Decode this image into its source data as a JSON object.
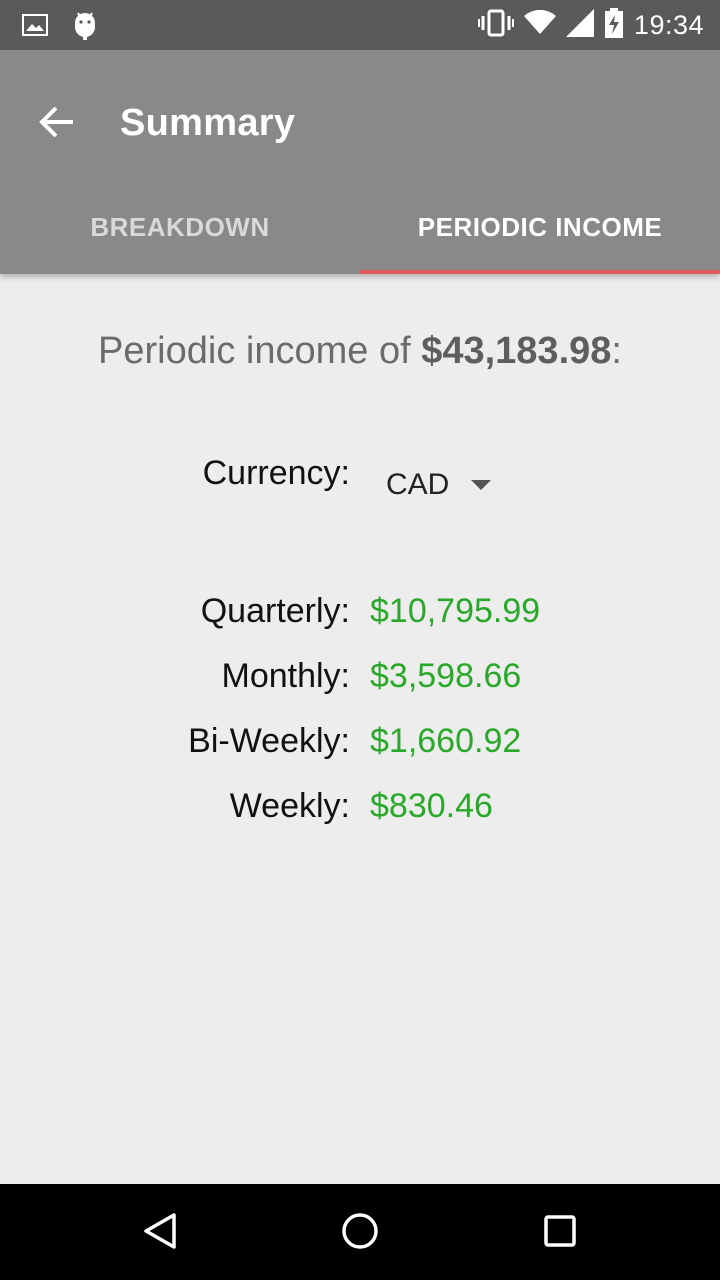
{
  "status_bar": {
    "time": "19:34",
    "icons": [
      "image-icon",
      "android-icon",
      "vibrate-icon",
      "wifi-icon",
      "signal-icon",
      "battery-charging-icon"
    ]
  },
  "app_bar": {
    "title": "Summary",
    "back_icon": "arrow-back-icon"
  },
  "tabs": [
    {
      "label": "BREAKDOWN",
      "active": false
    },
    {
      "label": "PERIODIC INCOME",
      "active": true
    }
  ],
  "colors": {
    "accent": "#e55a5a",
    "value_green": "#2aa82a",
    "app_bar": "#898989",
    "status_bar": "#5a5a5a"
  },
  "summary": {
    "prefix": "Periodic income of ",
    "amount": "$43,183.98",
    "suffix": ":"
  },
  "currency": {
    "label": "Currency:",
    "selected": "CAD"
  },
  "rows": [
    {
      "label": "Quarterly:",
      "value": "$10,795.99"
    },
    {
      "label": "Monthly:",
      "value": "$3,598.66"
    },
    {
      "label": "Bi-Weekly:",
      "value": "$1,660.92"
    },
    {
      "label": "Weekly:",
      "value": "$830.46"
    }
  ],
  "nav_bar": {
    "icons": [
      "back-triangle-icon",
      "home-circle-icon",
      "recents-square-icon"
    ]
  }
}
